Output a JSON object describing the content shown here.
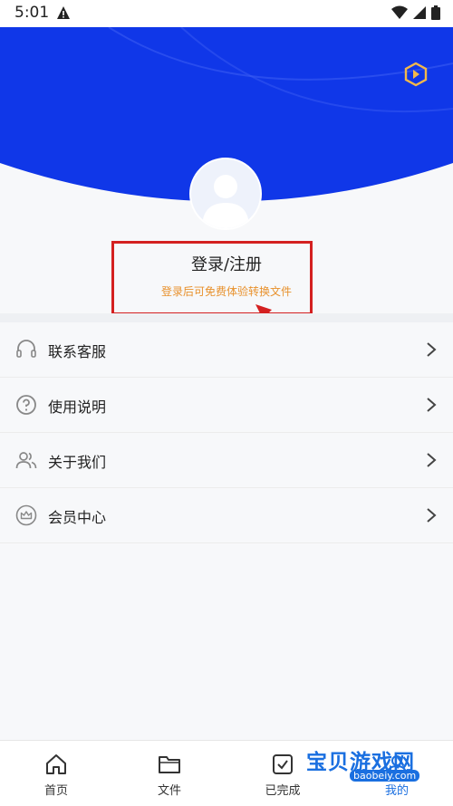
{
  "status_bar": {
    "time": "5:01"
  },
  "header": {
    "accent": "#1037e8"
  },
  "profile": {
    "login_title": "登录/注册",
    "login_subtitle": "登录后可免费体验转换文件"
  },
  "menu": {
    "items": [
      {
        "label": "联系客服",
        "icon": "headset-icon"
      },
      {
        "label": "使用说明",
        "icon": "question-icon"
      },
      {
        "label": "关于我们",
        "icon": "people-icon"
      },
      {
        "label": "会员中心",
        "icon": "crown-icon"
      }
    ]
  },
  "tabbar": {
    "tabs": [
      {
        "label": "首页",
        "icon": "home-icon"
      },
      {
        "label": "文件",
        "icon": "folder-icon"
      },
      {
        "label": "已完成",
        "icon": "done-icon"
      },
      {
        "label": "我的",
        "icon": "user-icon"
      }
    ]
  },
  "watermark": {
    "title": "宝贝游戏网",
    "url": "baobeiy.com"
  }
}
